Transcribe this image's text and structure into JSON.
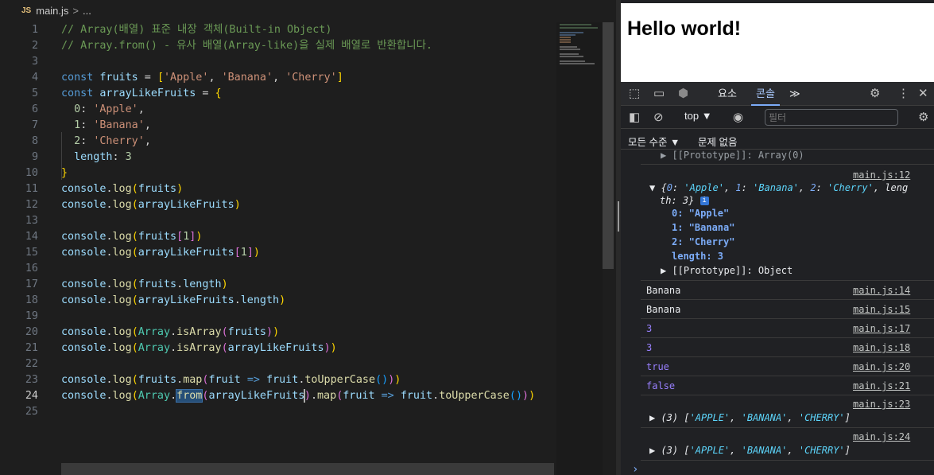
{
  "breadcrumb": {
    "file_icon": "JS",
    "file": "main.js",
    "separator": ">",
    "rest": "..."
  },
  "code_lines": [
    {
      "n": "1",
      "text": "// Array(배열) 표준 내장 객체(Built-in Object)"
    },
    {
      "n": "2",
      "text": "// Array.from() - 유사 배열(Array-like)을 실제 배열로 반환합니다."
    },
    {
      "n": "3",
      "text": ""
    },
    {
      "n": "4",
      "text": "const fruits = ['Apple', 'Banana', 'Cherry']"
    },
    {
      "n": "5",
      "text": "const arrayLikeFruits = {"
    },
    {
      "n": "6",
      "text": "  0: 'Apple',"
    },
    {
      "n": "7",
      "text": "  1: 'Banana',"
    },
    {
      "n": "8",
      "text": "  2: 'Cherry',"
    },
    {
      "n": "9",
      "text": "  length: 3"
    },
    {
      "n": "10",
      "text": "}"
    },
    {
      "n": "11",
      "text": "console.log(fruits)"
    },
    {
      "n": "12",
      "text": "console.log(arrayLikeFruits)"
    },
    {
      "n": "13",
      "text": ""
    },
    {
      "n": "14",
      "text": "console.log(fruits[1])"
    },
    {
      "n": "15",
      "text": "console.log(arrayLikeFruits[1])"
    },
    {
      "n": "16",
      "text": ""
    },
    {
      "n": "17",
      "text": "console.log(fruits.length)"
    },
    {
      "n": "18",
      "text": "console.log(arrayLikeFruits.length)"
    },
    {
      "n": "19",
      "text": ""
    },
    {
      "n": "20",
      "text": "console.log(Array.isArray(fruits))"
    },
    {
      "n": "21",
      "text": "console.log(Array.isArray(arrayLikeFruits))"
    },
    {
      "n": "22",
      "text": ""
    },
    {
      "n": "23",
      "text": "console.log(fruits.map(fruit => fruit.toUpperCase()))"
    },
    {
      "n": "24",
      "text": "console.log(Array.from(arrayLikeFruits).map(fruit => fruit.toUpperCase()))"
    },
    {
      "n": "25",
      "text": ""
    }
  ],
  "browser": {
    "page_heading": "Hello world!"
  },
  "devtools": {
    "tabs": {
      "elements": "요소",
      "console": "콘솔",
      "more": "≫"
    },
    "toolbar": {
      "context": "top",
      "context_arrow": "▼",
      "filter_placeholder": "필터"
    },
    "levels": {
      "label": "모든 수준 ▼",
      "issues": "문제 없음"
    },
    "console": {
      "proto_array_top": "▶ [[Prototype]]: Array(0)",
      "src12": "main.js:12",
      "obj_summary_a": "▼ {0: 'Apple', 1: 'Banana', 2: 'Cherry', leng",
      "obj_summary_b": "th: 3}",
      "info_badge": "i",
      "p0": "0: \"Apple\"",
      "p1": "1: \"Banana\"",
      "p2": "2: \"Cherry\"",
      "plen": "length: 3",
      "proto_obj": "▶ [[Prototype]]: Object",
      "r14": {
        "value": "Banana",
        "src": "main.js:14"
      },
      "r15": {
        "value": "Banana",
        "src": "main.js:15"
      },
      "r17": {
        "value": "3",
        "src": "main.js:17"
      },
      "r18": {
        "value": "3",
        "src": "main.js:18"
      },
      "r20": {
        "value": "true",
        "src": "main.js:20"
      },
      "r21": {
        "value": "false",
        "src": "main.js:21"
      },
      "r23": {
        "src": "main.js:23",
        "value": "▶ (3) ['APPLE', 'BANANA', 'CHERRY']"
      },
      "r24": {
        "src": "main.js:24",
        "value": "▶ (3) ['APPLE', 'BANANA', 'CHERRY']"
      },
      "prompt": "›"
    }
  }
}
